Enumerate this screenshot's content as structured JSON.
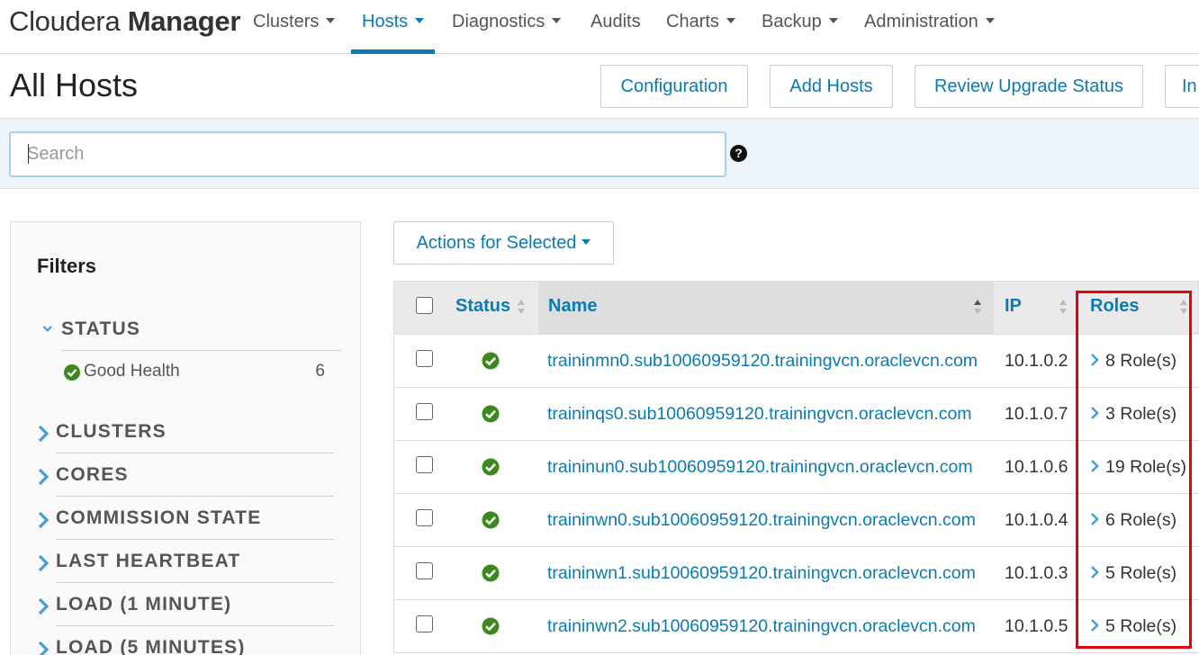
{
  "brand": {
    "light": "Cloudera ",
    "bold": "Manager"
  },
  "nav": {
    "clusters": "Clusters",
    "hosts": "Hosts",
    "diagnostics": "Diagnostics",
    "audits": "Audits",
    "charts": "Charts",
    "backup": "Backup",
    "administration": "Administration",
    "active": "hosts"
  },
  "page": {
    "title": "All Hosts",
    "buttons": {
      "configuration": "Configuration",
      "add_hosts": "Add Hosts",
      "review_upgrade": "Review Upgrade Status",
      "truncated": "In"
    }
  },
  "search": {
    "placeholder": "Search",
    "value": ""
  },
  "help_icon": "question-circle-icon",
  "filters": {
    "title": "Filters",
    "status": {
      "label": "STATUS",
      "expanded": true,
      "items": [
        {
          "label": "Good Health",
          "count": "6"
        }
      ]
    },
    "groups": [
      {
        "label": "CLUSTERS"
      },
      {
        "label": "CORES"
      },
      {
        "label": "COMMISSION STATE"
      },
      {
        "label": "LAST HEARTBEAT"
      },
      {
        "label": "LOAD (1 MINUTE)"
      },
      {
        "label": "LOAD (5 MINUTES)"
      }
    ]
  },
  "actions": {
    "label": "Actions for Selected"
  },
  "table": {
    "headers": {
      "status": "Status",
      "name": "Name",
      "ip": "IP",
      "roles": "Roles"
    },
    "rows": [
      {
        "name": "traininmn0.sub10060959120.trainingvcn.oraclevcn.com",
        "ip": "10.1.0.2",
        "roles": "8 Role(s)"
      },
      {
        "name": "traininqs0.sub10060959120.trainingvcn.oraclevcn.com",
        "ip": "10.1.0.7",
        "roles": "3 Role(s)"
      },
      {
        "name": "traininun0.sub10060959120.trainingvcn.oraclevcn.com",
        "ip": "10.1.0.6",
        "roles": "19 Role(s)"
      },
      {
        "name": "traininwn0.sub10060959120.trainingvcn.oraclevcn.com",
        "ip": "10.1.0.4",
        "roles": "6 Role(s)"
      },
      {
        "name": "traininwn1.sub10060959120.trainingvcn.oraclevcn.com",
        "ip": "10.1.0.3",
        "roles": "5 Role(s)"
      },
      {
        "name": "traininwn2.sub10060959120.trainingvcn.oraclevcn.com",
        "ip": "10.1.0.5",
        "roles": "5 Role(s)"
      }
    ]
  },
  "colors": {
    "accent": "#0a7bb5",
    "good": "#3c8a1e",
    "highlight": "#e4000f"
  }
}
